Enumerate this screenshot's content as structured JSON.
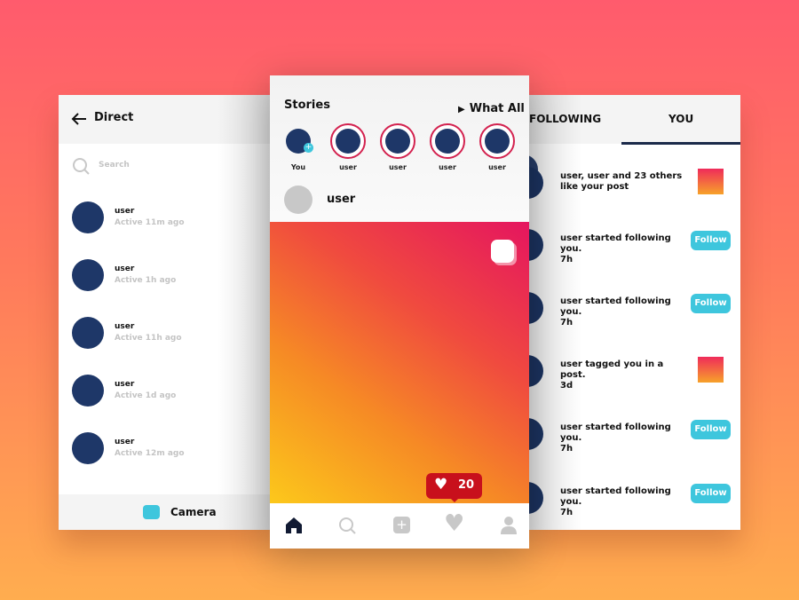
{
  "direct": {
    "title": "Direct",
    "search_placeholder": "Search",
    "contacts": [
      {
        "name": "user",
        "status": "Active 11m ago"
      },
      {
        "name": "user",
        "status": "Active 1h ago"
      },
      {
        "name": "user",
        "status": "Active 11h ago"
      },
      {
        "name": "user",
        "status": "Active 1d ago"
      },
      {
        "name": "user",
        "status": "Active 12m ago"
      }
    ],
    "camera_label": "Camera"
  },
  "feed": {
    "stories_title": "Stories",
    "watch_all": "What All",
    "stories": [
      {
        "label": "You"
      },
      {
        "label": "user"
      },
      {
        "label": "user"
      },
      {
        "label": "user"
      },
      {
        "label": "user"
      }
    ],
    "post_user": "user",
    "likes_count": "20",
    "nav": [
      "home-icon",
      "search-icon",
      "add-icon",
      "heart-icon",
      "profile-icon"
    ]
  },
  "activity": {
    "tabs": [
      "FOLLOWING",
      "YOU"
    ],
    "active_tab": "YOU",
    "follow_label": "Follow",
    "items": [
      {
        "text": "user, user and 23 others\nlike your post",
        "action": "thumbnail"
      },
      {
        "text": "user started following you.\n7h",
        "action": "follow"
      },
      {
        "text": "user started following you.\n7h",
        "action": "follow"
      },
      {
        "text": "user tagged you in a post.\n3d",
        "action": "thumbnail"
      },
      {
        "text": "user started following you.\n7h",
        "action": "follow"
      },
      {
        "text": "user started following you.\n7h",
        "action": "follow"
      }
    ]
  },
  "colors": {
    "avatar": "#1e3768",
    "accent": "#3ec6dd",
    "story_ring": "#d3224f",
    "badge": "#c8101c"
  }
}
